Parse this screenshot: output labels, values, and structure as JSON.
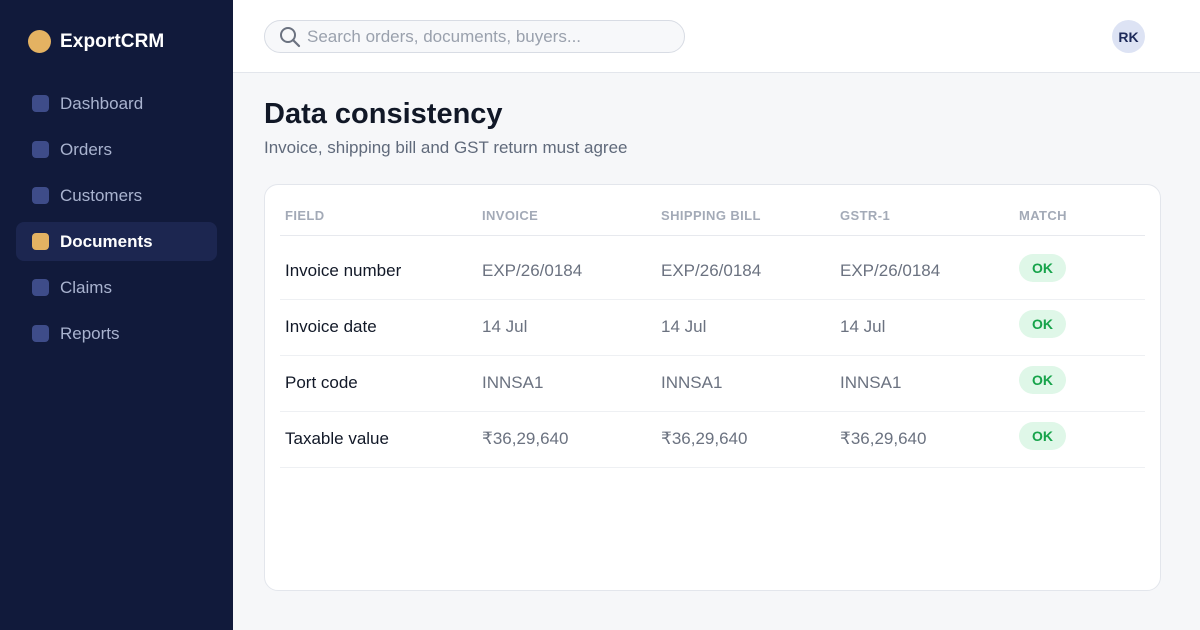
{
  "app": {
    "name": "ExportCRM"
  },
  "colors": {
    "sidebar_bg": "#111a3b",
    "accent": "#e4b262",
    "ok_bg": "#dff7e8",
    "ok_text": "#16a34a"
  },
  "sidebar": {
    "items": [
      {
        "label": "Dashboard",
        "active": false
      },
      {
        "label": "Orders",
        "active": false
      },
      {
        "label": "Customers",
        "active": false
      },
      {
        "label": "Documents",
        "active": true
      },
      {
        "label": "Claims",
        "active": false
      },
      {
        "label": "Reports",
        "active": false
      }
    ]
  },
  "search": {
    "placeholder": "Search orders, documents, buyers...",
    "icon": "search-icon"
  },
  "user": {
    "initials": "RK"
  },
  "page": {
    "title": "Data consistency",
    "subtitle": "Invoice, shipping bill and GST return must agree"
  },
  "table": {
    "headers": [
      "FIELD",
      "INVOICE",
      "SHIPPING BILL",
      "GSTR-1",
      "MATCH"
    ],
    "rows": [
      {
        "field": "Invoice number",
        "invoice": "EXP/26/0184",
        "shipping_bill": "EXP/26/0184",
        "gstr1": "EXP/26/0184",
        "match": "OK"
      },
      {
        "field": "Invoice date",
        "invoice": "14 Jul",
        "shipping_bill": "14 Jul",
        "gstr1": "14 Jul",
        "match": "OK"
      },
      {
        "field": "Port code",
        "invoice": "INNSA1",
        "shipping_bill": "INNSA1",
        "gstr1": "INNSA1",
        "match": "OK"
      },
      {
        "field": "Taxable value",
        "invoice": "₹36,29,640",
        "shipping_bill": "₹36,29,640",
        "gstr1": "₹36,29,640",
        "match": "OK"
      }
    ]
  }
}
